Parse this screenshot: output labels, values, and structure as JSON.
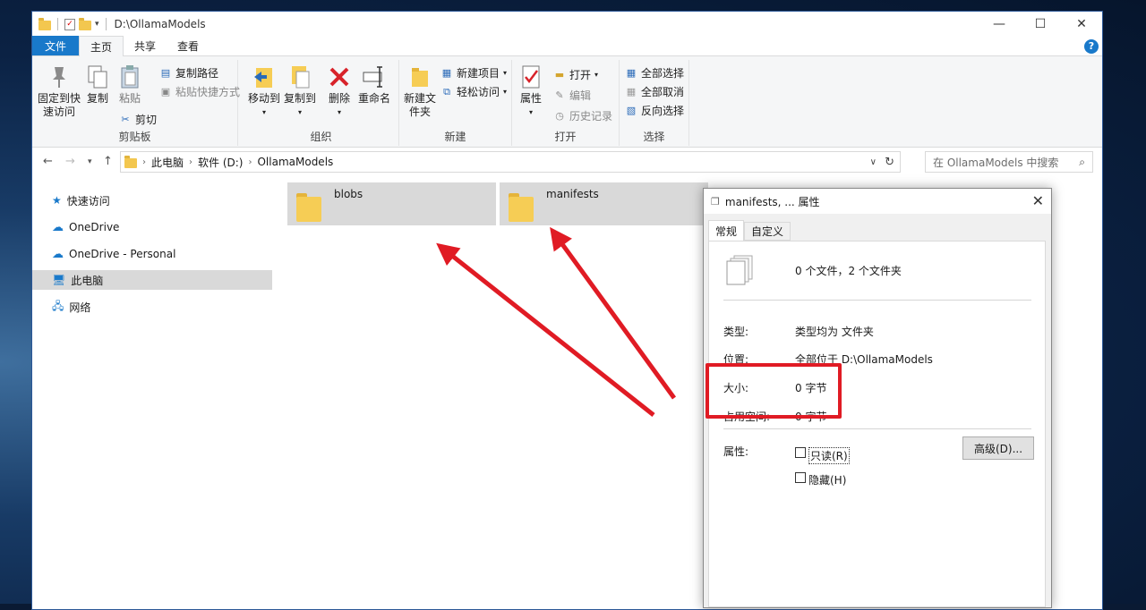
{
  "window": {
    "title": "D:\\OllamaModels",
    "controls": {
      "minimize": "—",
      "maximize": "☐",
      "close": "✕"
    }
  },
  "tabs": [
    "文件",
    "主页",
    "共享",
    "查看"
  ],
  "ribbon": {
    "clipboard": {
      "pin": "固定到快速访问",
      "copy": "复制",
      "paste": "粘贴",
      "copy_path": "复制路径",
      "paste_shortcut": "粘贴快捷方式",
      "cut": "剪切",
      "group": "剪贴板"
    },
    "organize": {
      "move_to": "移动到",
      "copy_to": "复制到",
      "delete": "删除",
      "rename": "重命名",
      "group": "组织"
    },
    "new": {
      "new_folder": "新建文件夹",
      "new_item": "新建项目",
      "easy_access": "轻松访问",
      "group": "新建"
    },
    "open": {
      "properties": "属性",
      "open": "打开",
      "edit": "编辑",
      "history": "历史记录",
      "group": "打开"
    },
    "select": {
      "select_all": "全部选择",
      "select_none": "全部取消",
      "invert": "反向选择",
      "group": "选择"
    }
  },
  "address": {
    "crumbs": [
      "此电脑",
      "软件 (D:)",
      "OllamaModels"
    ],
    "search_placeholder": "在 OllamaModels 中搜索"
  },
  "sidebar": {
    "items": [
      "快速访问",
      "OneDrive",
      "OneDrive - Personal",
      "此电脑",
      "网络"
    ],
    "selected": "此电脑"
  },
  "folders": [
    "blobs",
    "manifests"
  ],
  "dialog": {
    "title": "manifests, ... 属性",
    "tabs": [
      "常规",
      "自定义"
    ],
    "summary": "0 个文件，2 个文件夹",
    "type_label": "类型:",
    "type_value": "类型均为 文件夹",
    "location_label": "位置:",
    "location_value": "全部位于 D:\\OllamaModels",
    "size_label": "大小:",
    "size_value": "0 字节",
    "disk_label": "占用空间:",
    "disk_value": "0 字节",
    "attrs_label": "属性:",
    "readonly": "只读(R)",
    "hidden": "隐藏(H)",
    "advanced": "高级(D)..."
  },
  "colors": {
    "accent": "#1979ca",
    "highlight": "#e01b24",
    "folder": "#f6cd55",
    "selection": "#d9d9d9"
  }
}
